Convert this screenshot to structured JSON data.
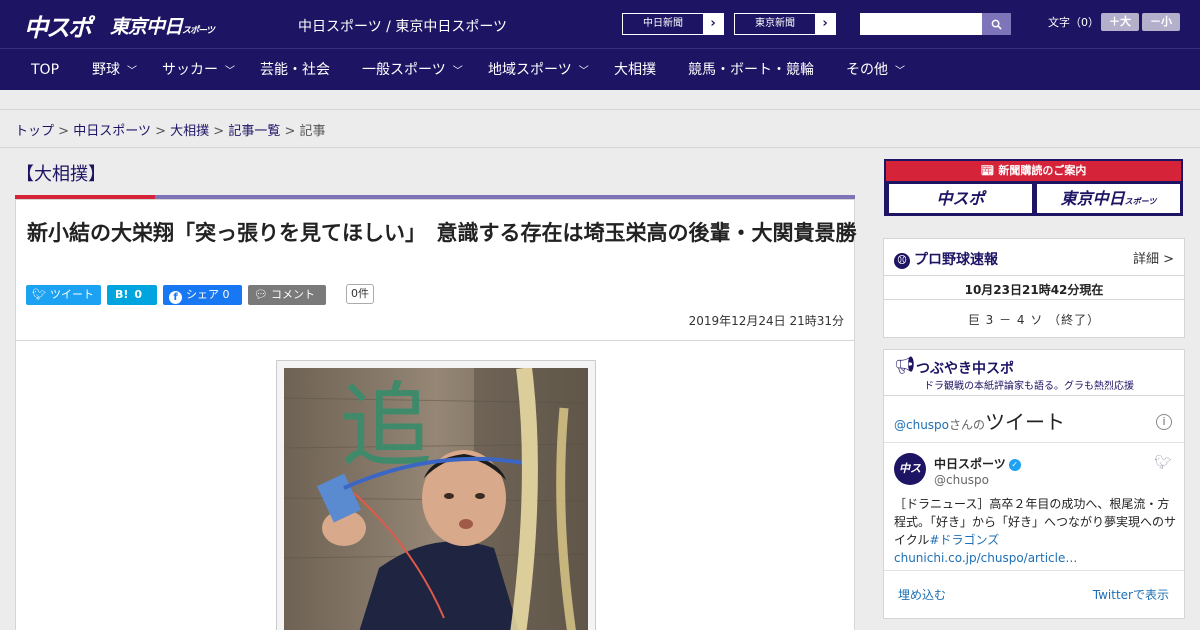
{
  "header": {
    "logo_primary": "中スポ",
    "logo_secondary": "東京中日",
    "logo_secondary_small": "スポーツ",
    "site_name": "中日スポーツ / 東京中日スポーツ",
    "ext_links": [
      "中日新聞",
      "東京新聞"
    ],
    "search_placeholder": "",
    "font_size_label": "文字（0）",
    "font_plus": "＋大",
    "font_minus": "－小"
  },
  "nav": {
    "items": [
      {
        "label": "TOP",
        "dropdown": false
      },
      {
        "label": "野球",
        "dropdown": true
      },
      {
        "label": "サッカー",
        "dropdown": true
      },
      {
        "label": "芸能・社会",
        "dropdown": false
      },
      {
        "label": "一般スポーツ",
        "dropdown": true
      },
      {
        "label": "地域スポーツ",
        "dropdown": true
      },
      {
        "label": "大相撲",
        "dropdown": false
      },
      {
        "label": "競馬・ボート・競輪",
        "dropdown": false
      },
      {
        "label": "その他",
        "dropdown": true
      }
    ]
  },
  "breadcrumb": {
    "items": [
      "トップ",
      "中日スポーツ",
      "大相撲",
      "記事一覧"
    ],
    "current": "記事",
    "separator": ">"
  },
  "article": {
    "category": "【大相撲】",
    "headline": "新小結の大栄翔「突っ張りを見てほしい」　意識する存在は埼玉栄高の後輩・大関貴景勝",
    "share": {
      "tweet": "ツイート",
      "hatena": "B!",
      "hatena_count": "0",
      "facebook": "シェア",
      "facebook_count": "0",
      "comment": "コメント",
      "comment_count": "0件"
    },
    "date": "2019年12月24日 21時31分",
    "photo_kanji": "追"
  },
  "sidebar": {
    "ad_title": "新聞購読のご案内",
    "ad_options": [
      "中スポ",
      "東京中日"
    ],
    "ad_option_small": "スポーツ",
    "baseball": {
      "title": "プロ野球速報",
      "detail": "詳細 >",
      "time": "10月23日21時42分現在",
      "score": "巨 3 － 4 ソ （終了）"
    },
    "tweets": {
      "title": "つぶやき中スポ",
      "subtitle": "ドラ観戦の本紙評論家も語る。グラも熱烈応援",
      "header_handle": "@chuspo",
      "header_mid": "さんの",
      "header_big": "ツイート",
      "account_name": "中日スポーツ",
      "account_handle": "@chuspo",
      "avatar_text": "中スポ",
      "text_main": "［ドラニュース］高卒２年目の成功へ、根尾流・方程式。「好き」から「好き」へつながり夢実現へのサイクル",
      "text_link": "#ドラゴンズchunichi.co.jp/chuspo/article…",
      "embed": "埋め込む",
      "view": "Twitterで表示"
    }
  },
  "colors": {
    "brand_navy": "#1d1464",
    "accent_red": "#d5243a",
    "accent_purple": "#7d73b6",
    "twitter_blue": "#1da1f2",
    "hatena_blue": "#00a4de",
    "facebook_blue": "#1877f2",
    "comment_gray": "#7a7a7a"
  }
}
